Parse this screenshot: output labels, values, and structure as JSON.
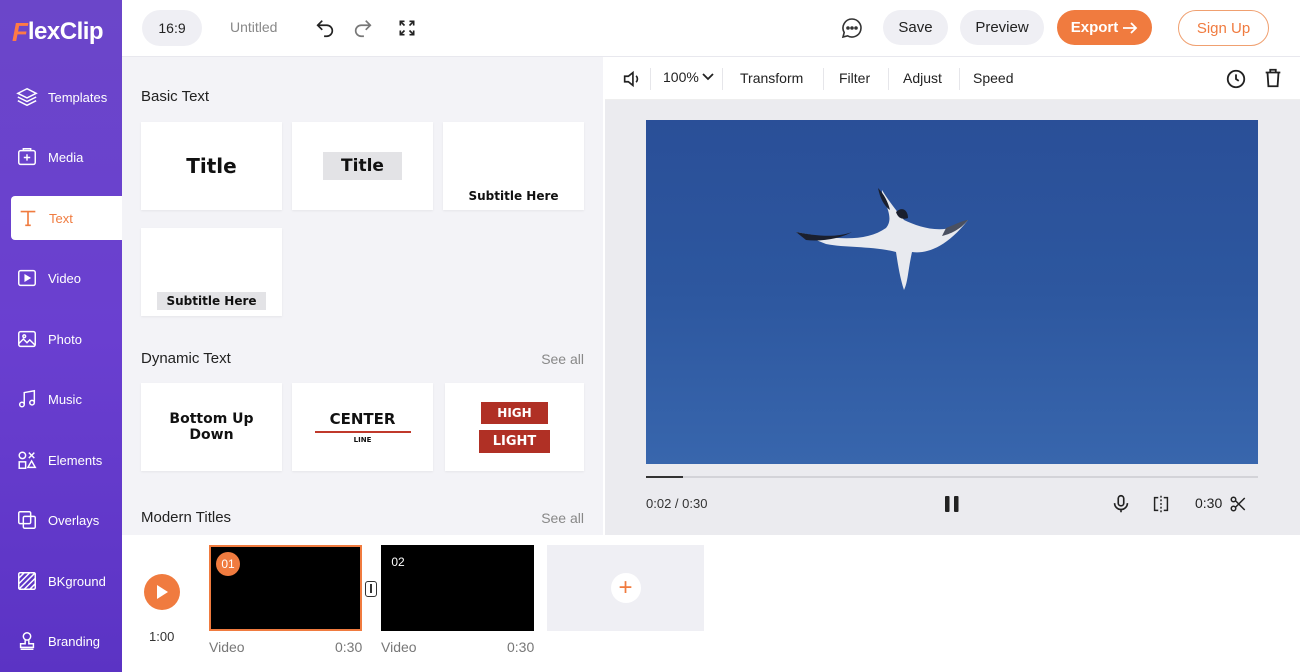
{
  "app": {
    "logo_first": "F",
    "logo_rest": "lexClip"
  },
  "sidebar": {
    "items": [
      {
        "label": "Templates",
        "icon": "layers-icon"
      },
      {
        "label": "Media",
        "icon": "media-icon"
      },
      {
        "label": "Text",
        "icon": "text-icon",
        "active": true
      },
      {
        "label": "Video",
        "icon": "video-icon"
      },
      {
        "label": "Photo",
        "icon": "photo-icon"
      },
      {
        "label": "Music",
        "icon": "music-icon"
      },
      {
        "label": "Elements",
        "icon": "elements-icon"
      },
      {
        "label": "Overlays",
        "icon": "overlays-icon"
      },
      {
        "label": "BKground",
        "icon": "background-icon"
      },
      {
        "label": "Branding",
        "icon": "branding-icon"
      }
    ]
  },
  "topbar": {
    "ratio": "16:9",
    "doc_title": "Untitled",
    "save_label": "Save",
    "preview_label": "Preview",
    "export_label": "Export",
    "signup_label": "Sign Up"
  },
  "panel": {
    "basic_text": {
      "title": "Basic Text",
      "cards": [
        "Title",
        "Title",
        "Subtitle Here",
        "Subtitle Here"
      ]
    },
    "dynamic_text": {
      "title": "Dynamic Text",
      "see_all": "See all",
      "cards": [
        {
          "line1": "Bottom Up",
          "line2": "Down"
        },
        {
          "line1": "CENTER",
          "line2": "LINE"
        },
        {
          "line1": "HIGH",
          "line2": "LIGHT"
        }
      ]
    },
    "modern_titles": {
      "title": "Modern Titles",
      "see_all": "See all"
    }
  },
  "toolbar": {
    "zoom": "100%",
    "transform": "Transform",
    "filter": "Filter",
    "adjust": "Adjust",
    "speed": "Speed"
  },
  "preview": {
    "current_time": "0:02 / 0:30",
    "clip_duration": "0:30",
    "progress": 0.06
  },
  "timeline": {
    "total_time": "1:00",
    "clips": [
      {
        "num": "01",
        "label": "Video",
        "duration": "0:30",
        "selected": true
      },
      {
        "num": "02",
        "label": "Video",
        "duration": "0:30",
        "selected": false
      }
    ]
  },
  "colors": {
    "accent": "#f07b3f",
    "sidebar": "#6a3fd0"
  }
}
